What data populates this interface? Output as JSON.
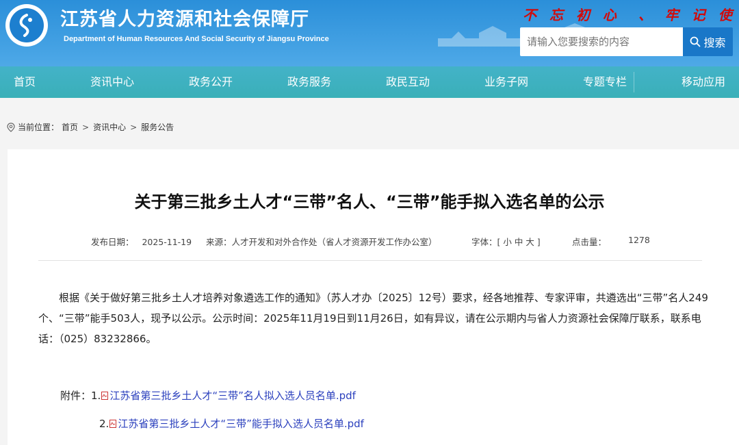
{
  "header": {
    "title": "江苏省人力资源和社会保障厅",
    "subtitle": "Department of Human Resources And Social Security of Jiangsu Province",
    "slogan": "不 忘 初 心  、 牢 记 使 命"
  },
  "search": {
    "placeholder": "请输入您要搜索的内容",
    "button_label": "搜索"
  },
  "nav": {
    "items": [
      {
        "label": "首页"
      },
      {
        "label": "资讯中心"
      },
      {
        "label": "政务公开"
      },
      {
        "label": "政务服务"
      },
      {
        "label": "政民互动"
      },
      {
        "label": "业务子网"
      },
      {
        "label": "专题专栏"
      },
      {
        "label": "移动应用"
      }
    ]
  },
  "breadcrumb": {
    "prefix": "当前位置：",
    "items": [
      "首页",
      "资讯中心",
      "服务公告"
    ]
  },
  "article": {
    "title": "关于第三批乡土人才“三带”名人、“三带”能手拟入选名单的公示",
    "meta": {
      "date_label": "发布日期：",
      "date": "2025-11-19",
      "source_label": "来源：",
      "source": "人才开发和对外合作处（省人才资源开发工作办公室）",
      "font_label": "字体：",
      "font_options": "[ 小  中  大 ]",
      "clicks_label": "点击量：",
      "clicks": "1278"
    },
    "body": "根据《关于做好第三批乡土人才培养对象遴选工作的通知》（苏人才办〔2025〕12号）要求，经各地推荐、专家评审，共遴选出“三带”名人249个、“三带”能手503人，现予以公示。公示时间：2025年11月19日到11月26日，如有异议，请在公示期内与省人力资源社会保障厅联系，联系电话：（025）83232866。",
    "attachments_label": "附件：",
    "attachments": [
      {
        "index": "1.",
        "name": "江苏省第三批乡土人才“三带”名人拟入选人员名单.pdf"
      },
      {
        "index": "2.",
        "name": "江苏省第三批乡土人才“三带”能手拟入选人员名单.pdf"
      }
    ]
  },
  "colors": {
    "header_blue": "#2b8fd9",
    "nav_teal": "#3ab0b8",
    "search_button": "#1977c8",
    "slogan_red": "#d10a0a",
    "link_blue": "#2a3fbd"
  },
  "icons": [
    "emblem-logo",
    "search-icon",
    "location-pin-icon",
    "pdf-icon"
  ]
}
